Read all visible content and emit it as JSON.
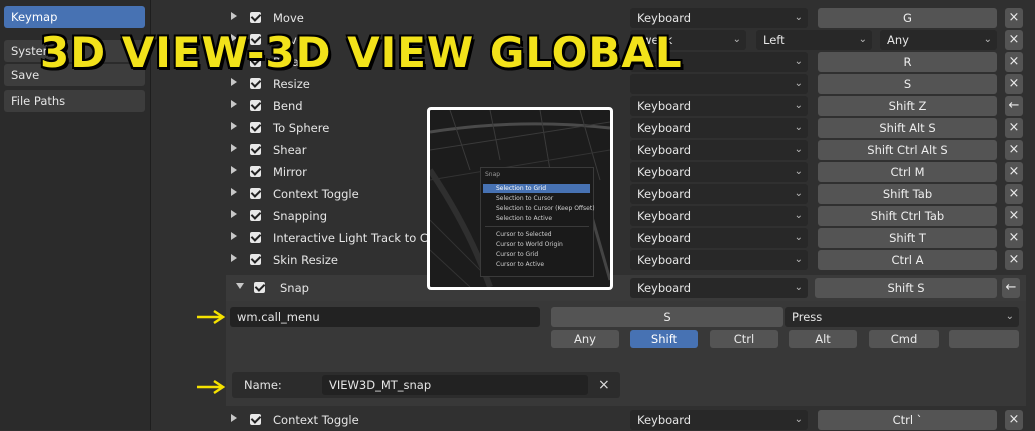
{
  "sidebar": {
    "items": [
      {
        "label": "Keymap",
        "active": true
      },
      {
        "label": "System",
        "active": false
      },
      {
        "label": "Save",
        "active": false
      },
      {
        "label": "File Paths",
        "active": false
      }
    ]
  },
  "overlay_title": "3D VIEW-3D VIEW GLOBAL",
  "rows": [
    {
      "name": "Move",
      "device": "Keyboard",
      "key": "G",
      "x": "×"
    },
    {
      "name": "Move",
      "device": "Tweak",
      "button": "Left",
      "value": "Any",
      "x": "×"
    },
    {
      "name": "Rotate",
      "device": "",
      "key": "R",
      "x": "×"
    },
    {
      "name": "Resize",
      "device": "",
      "key": "S",
      "x": "×"
    },
    {
      "name": "Bend",
      "device": "Keyboard",
      "key": "Shift Z",
      "x": "←"
    },
    {
      "name": "To Sphere",
      "device": "Keyboard",
      "key": "Shift Alt S",
      "x": "×"
    },
    {
      "name": "Shear",
      "device": "Keyboard",
      "key": "Shift Ctrl Alt S",
      "x": "×"
    },
    {
      "name": "Mirror",
      "device": "Keyboard",
      "key": "Ctrl M",
      "x": "×"
    },
    {
      "name": "Context Toggle",
      "device": "Keyboard",
      "key": "Shift Tab",
      "x": "×"
    },
    {
      "name": "Snapping",
      "device": "Keyboard",
      "key": "Shift Ctrl Tab",
      "x": "×"
    },
    {
      "name": "Interactive Light Track to Cursor",
      "device": "Keyboard",
      "key": "Shift T",
      "x": "×"
    },
    {
      "name": "Skin Resize",
      "device": "Keyboard",
      "key": "Ctrl A",
      "x": "×"
    }
  ],
  "snap": {
    "name": "Snap",
    "device": "Keyboard",
    "key": "Shift S",
    "x": "←",
    "operator": "wm.call_menu",
    "event_key": "S",
    "event_type": "Press",
    "modifiers": [
      {
        "label": "Any",
        "on": false
      },
      {
        "label": "Shift",
        "on": true
      },
      {
        "label": "Ctrl",
        "on": false
      },
      {
        "label": "Alt",
        "on": false
      },
      {
        "label": "Cmd",
        "on": false
      },
      {
        "label": "",
        "on": false
      }
    ],
    "prop_label": "Name:",
    "prop_value": "VIEW3D_MT_snap",
    "prop_clear": "×"
  },
  "last_row": {
    "name": "Context Toggle",
    "device": "Keyboard",
    "key": "Ctrl `",
    "x": "×"
  },
  "inset_menu": {
    "title": "Snap",
    "items": [
      {
        "label": "Selection to Grid",
        "highlight": true
      },
      {
        "label": "Selection to Cursor",
        "highlight": false
      },
      {
        "label": "Selection to Cursor (Keep Offset)",
        "highlight": false
      },
      {
        "label": "Selection to Active",
        "highlight": false
      },
      {
        "label": "Cursor to Selected",
        "highlight": false
      },
      {
        "label": "Cursor to World Origin",
        "highlight": false
      },
      {
        "label": "Cursor to Grid",
        "highlight": false
      },
      {
        "label": "Cursor to Active",
        "highlight": false
      }
    ]
  },
  "colors": {
    "accent": "#4772b3",
    "title_yellow": "#f2e21a",
    "arrow_yellow": "#f5e200"
  }
}
